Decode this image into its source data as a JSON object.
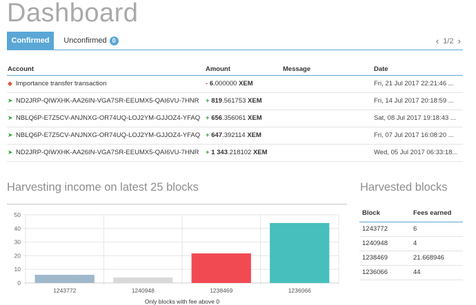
{
  "page": {
    "title": "Dashboard"
  },
  "tabs": {
    "confirmed_label": "Confirmed",
    "unconfirmed_label": "Unconfirmed",
    "unconfirmed_count": "0",
    "page_indicator": "1/2"
  },
  "transactions": {
    "headers": {
      "account": "Account",
      "amount": "Amount",
      "message": "Message",
      "date": "Date"
    },
    "rows": [
      {
        "icon": "importance-transfer-icon",
        "account": "Importance transfer transaction",
        "sign": "-",
        "amount_bold": "6",
        "amount_rest": ".000000",
        "unit": "XEM",
        "message": "",
        "date": "Fri, 21 Jul 2017 22:21:46 ..."
      },
      {
        "icon": "outgoing-transfer-icon",
        "account": "ND2JRP-QIWXHK-AA26IN-VGA7SR-EEUMX5-QAI6VU-7HNR",
        "sign": "+",
        "amount_bold": "819",
        "amount_rest": ".561753",
        "unit": "XEM",
        "message": "",
        "date": "Fri, 14 Jul 2017 20:18:59 ..."
      },
      {
        "icon": "outgoing-transfer-icon",
        "account": "NBLQ6P-E7Z5CV-ANJNXG-OR74UQ-LOJ2YM-GJJOZ4-YFAQ",
        "sign": "+",
        "amount_bold": "656",
        "amount_rest": ".356061",
        "unit": "XEM",
        "message": "",
        "date": "Sat, 08 Jul 2017 19:18:43 ..."
      },
      {
        "icon": "outgoing-transfer-icon",
        "account": "NBLQ6P-E7Z5CV-ANJNXG-OR74UQ-LOJ2YM-GJJOZ4-YFAQ",
        "sign": "+",
        "amount_bold": "647",
        "amount_rest": ".392114",
        "unit": "XEM",
        "message": "",
        "date": "Fri, 07 Jul 2017 16:08:20 ..."
      },
      {
        "icon": "outgoing-transfer-icon",
        "account": "ND2JRP-QIWXHK-AA26IN-VGA7SR-EEUMX5-QAI6VU-7HNR",
        "sign": "+",
        "amount_bold": "1 343",
        "amount_rest": ".218102",
        "unit": "XEM",
        "message": "",
        "date": "Wed, 05 Jul 2017 06:33:18..."
      }
    ]
  },
  "harvesting": {
    "title": "Harvesting income on latest 25 blocks",
    "footnote": "Only blocks with fee above 0"
  },
  "chart_data": {
    "type": "bar",
    "categories": [
      "1243772",
      "1240948",
      "1238469",
      "1236066"
    ],
    "values": [
      6,
      4,
      21.668946,
      44
    ],
    "colors": [
      "#9fb8cb",
      "#d9d9d9",
      "#f24a52",
      "#46bfbd"
    ],
    "ylim": [
      0,
      50
    ],
    "yticks": [
      "0",
      "10",
      "20",
      "30",
      "40",
      "50"
    ],
    "grid": true,
    "xlabel": "Only blocks with fee above 0"
  },
  "harvested_blocks": {
    "title": "Harvested blocks",
    "headers": {
      "block": "Block",
      "fees": "Fees earned"
    },
    "rows": [
      {
        "block": "1243772",
        "fees": "6"
      },
      {
        "block": "1240948",
        "fees": "4"
      },
      {
        "block": "1238469",
        "fees": "21.668946"
      },
      {
        "block": "1236066",
        "fees": "44"
      }
    ]
  }
}
